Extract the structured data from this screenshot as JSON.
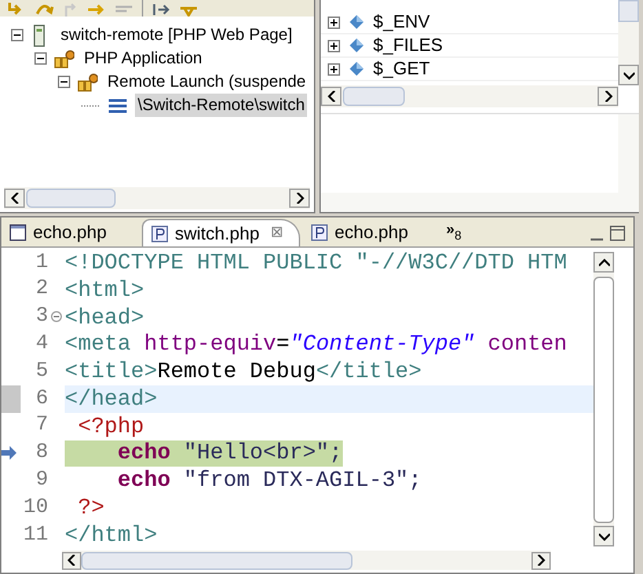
{
  "debug_tree": [
    {
      "label": "switch-remote [PHP Web Page]",
      "kind": "server",
      "expanded": true,
      "selected": false,
      "children": [
        {
          "label": "PHP Application",
          "kind": "app",
          "expanded": true,
          "selected": false,
          "children": [
            {
              "label": "Remote Launch (suspende",
              "kind": "launch",
              "expanded": true,
              "selected": false,
              "children": [
                {
                  "label": "\\Switch-Remote\\switch",
                  "kind": "frame",
                  "selected": true
                }
              ]
            }
          ]
        }
      ]
    }
  ],
  "variables": [
    {
      "name": "$_ENV",
      "expanded": false
    },
    {
      "name": "$_FILES",
      "expanded": false
    },
    {
      "name": "$_GET",
      "expanded": false
    }
  ],
  "editor_tabs": [
    {
      "label": "echo.php",
      "kind": "html",
      "selected": false
    },
    {
      "label": "switch.php",
      "kind": "php",
      "selected": true,
      "close": "⊠"
    },
    {
      "label": "echo.php",
      "kind": "php",
      "selected": false
    }
  ],
  "tab_overflow": {
    "chevron": "»",
    "count": "8"
  },
  "code_lines": [
    {
      "number": "1",
      "fold": false,
      "highlighted": false,
      "current": false,
      "tokens": [
        {
          "t": "<!DOCTYPE HTML PUBLIC \"-//W3C//DTD HTM",
          "kind": "tag"
        }
      ]
    },
    {
      "number": "2",
      "fold": false,
      "highlighted": false,
      "current": false,
      "tokens": [
        {
          "t": "<html>",
          "kind": "tag"
        }
      ]
    },
    {
      "number": "3",
      "fold": true,
      "highlighted": false,
      "current": false,
      "tokens": [
        {
          "t": "<head>",
          "kind": "tag"
        }
      ]
    },
    {
      "number": "4",
      "fold": false,
      "highlighted": false,
      "current": false,
      "tokens": [
        {
          "t": "<meta",
          "kind": "tag"
        },
        {
          "t": " http-equiv",
          "kind": "attr"
        },
        {
          "t": "=",
          "kind": "text"
        },
        {
          "t": "\"Content-Type\"",
          "kind": "value"
        },
        {
          "t": " conten",
          "kind": "attr"
        }
      ]
    },
    {
      "number": "5",
      "fold": false,
      "highlighted": false,
      "current": false,
      "tokens": [
        {
          "t": "<title>",
          "kind": "tag"
        },
        {
          "t": "Remote Debug",
          "kind": "text"
        },
        {
          "t": "</title>",
          "kind": "tag"
        }
      ]
    },
    {
      "number": "6",
      "fold": false,
      "highlighted": true,
      "current": false,
      "tokens": [
        {
          "t": "</head>",
          "kind": "tag"
        }
      ]
    },
    {
      "number": "7",
      "fold": false,
      "highlighted": false,
      "current": false,
      "tokens": [
        {
          "t": " <?php",
          "kind": "php"
        }
      ]
    },
    {
      "number": "8",
      "fold": false,
      "highlighted": false,
      "current": true,
      "tokens": [
        {
          "t": "    echo",
          "kind": "keyword"
        },
        {
          "t": " \"Hello<br>\";",
          "kind": "string"
        }
      ]
    },
    {
      "number": "9",
      "fold": false,
      "highlighted": false,
      "current": false,
      "tokens": [
        {
          "t": "    echo",
          "kind": "keyword"
        },
        {
          "t": " \"from DTX-AGIL-3\";",
          "kind": "string"
        }
      ]
    },
    {
      "number": "10",
      "fold": false,
      "highlighted": false,
      "current": false,
      "tokens": [
        {
          "t": " ?>",
          "kind": "php"
        }
      ]
    },
    {
      "number": "11",
      "fold": false,
      "highlighted": false,
      "current": false,
      "tokens": [
        {
          "t": "</html>",
          "kind": "tag"
        }
      ]
    }
  ]
}
